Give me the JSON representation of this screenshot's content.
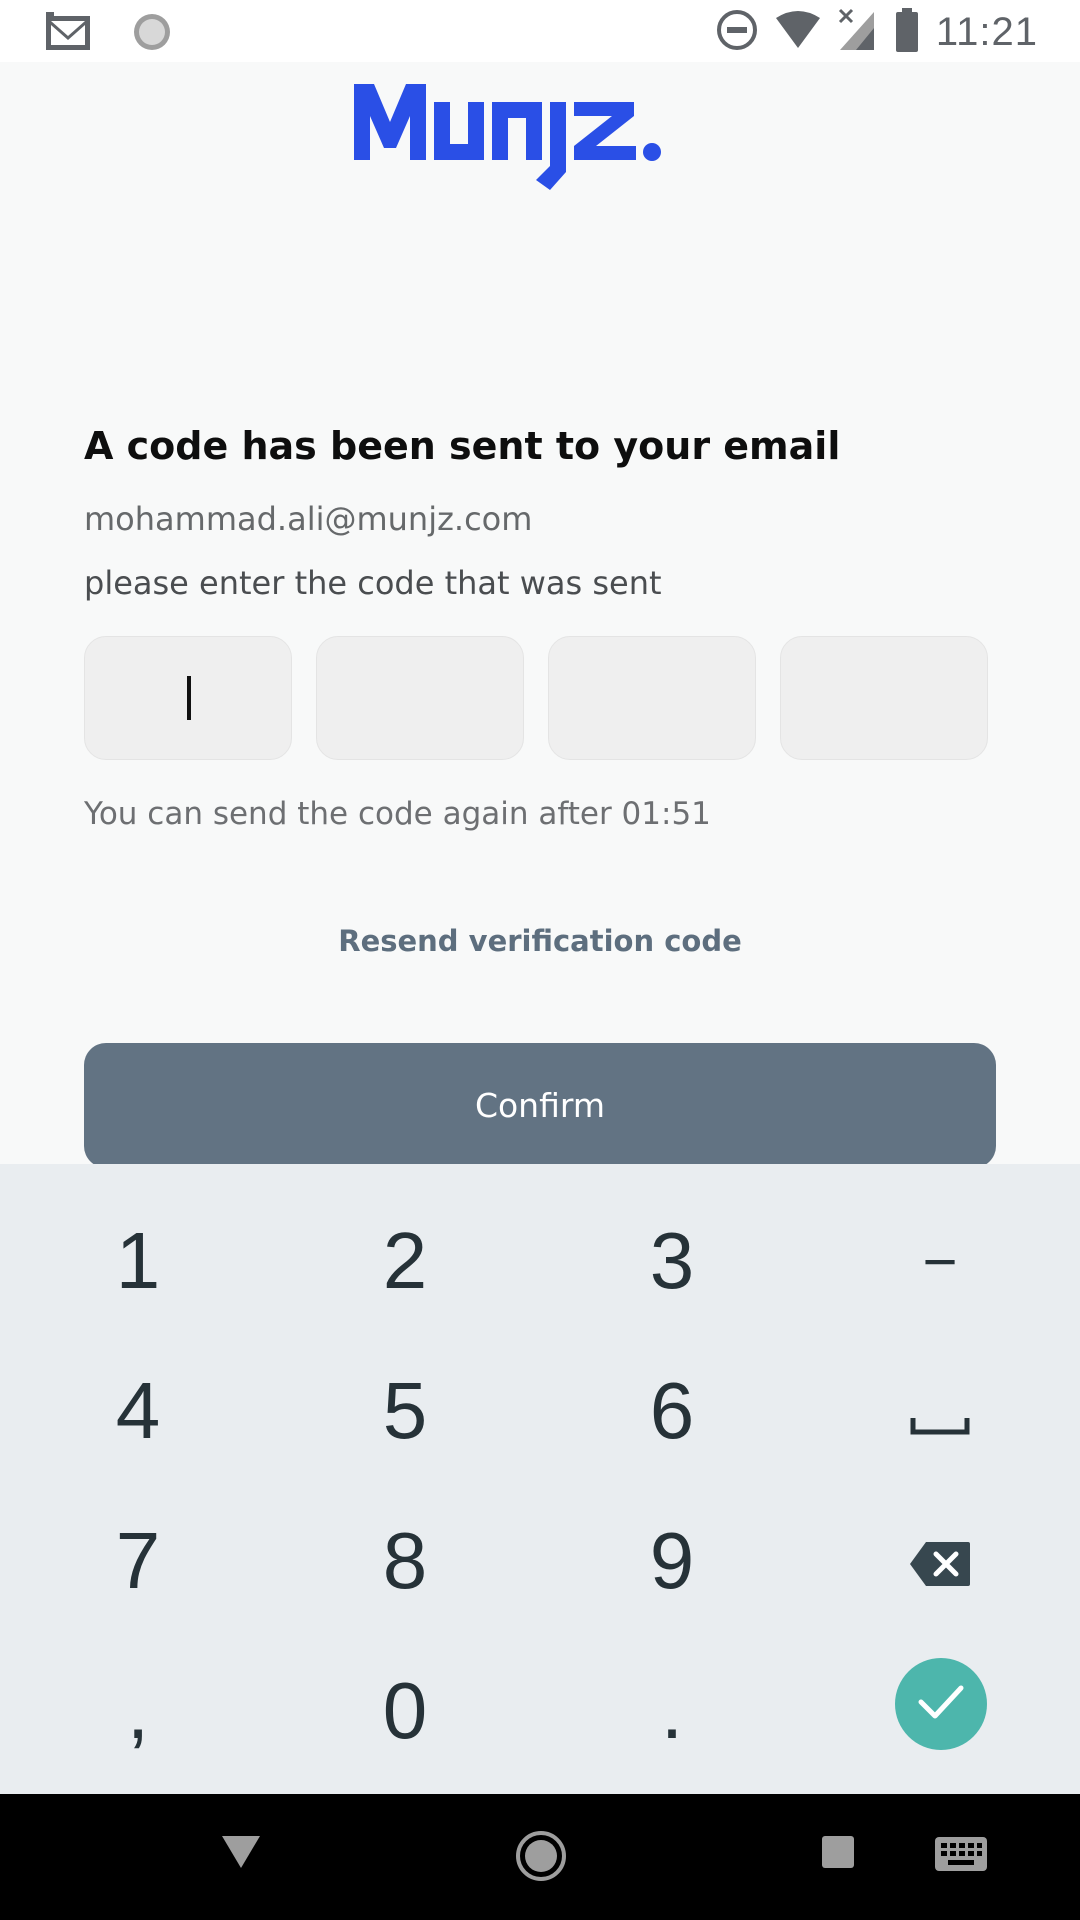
{
  "status_bar": {
    "time": "11:21",
    "left_icons": [
      "gmail-icon",
      "sync-icon"
    ],
    "right_icons": [
      "do-not-disturb-icon",
      "wifi-icon",
      "no-signal-icon",
      "battery-icon"
    ]
  },
  "brand": {
    "logo_text": "Munjz.",
    "color": "#2a4fe6"
  },
  "verification": {
    "heading": "A code has been sent to your email",
    "email": "mohammad.ali@munjz.com",
    "instruction": "please enter the code that was sent",
    "code_digits": [
      "",
      "",
      "",
      ""
    ],
    "timer_text": "You can send the code again after 01:51",
    "resend_label": "Resend verification code",
    "confirm_label": "Confirm"
  },
  "keyboard": {
    "rows": [
      [
        "1",
        "2",
        "3",
        "−"
      ],
      [
        "4",
        "5",
        "6",
        "space-icon"
      ],
      [
        "7",
        "8",
        "9",
        "backspace-icon"
      ],
      [
        ",",
        "0",
        ".",
        "done-icon"
      ]
    ],
    "k1": "1",
    "k2": "2",
    "k3": "3",
    "k_minus": "−",
    "k4": "4",
    "k5": "5",
    "k6": "6",
    "k7": "7",
    "k8": "8",
    "k9": "9",
    "k_comma": ",",
    "k0": "0",
    "k_period": ".",
    "accent": "#4db6ac"
  },
  "nav_bar": {
    "icons": [
      "back-icon",
      "home-icon",
      "recents-icon",
      "keyboard-switch-icon"
    ]
  }
}
